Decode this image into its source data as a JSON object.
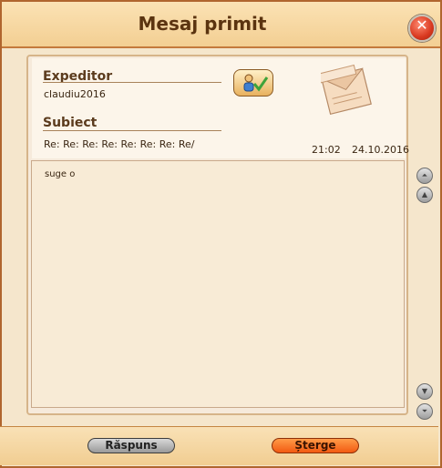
{
  "window": {
    "title": "Mesaj primit"
  },
  "message": {
    "sender_label": "Expeditor",
    "sender": "claudiu2016",
    "subject_label": "Subiect",
    "subject": "Re: Re: Re: Re: Re: Re: Re: Re/",
    "time": "21:02",
    "date": "24.10.2016",
    "body": "suge o"
  },
  "actions": {
    "reply_label": "Răspuns",
    "delete_label": "Șterge"
  },
  "icons": {
    "close": "close-icon",
    "add_friend": "add-friend-icon",
    "envelope": "envelope-icon",
    "scroll_top": "scroll-top-icon",
    "scroll_up": "scroll-up-icon",
    "scroll_down": "scroll-down-icon",
    "scroll_bottom": "scroll-bottom-icon"
  }
}
